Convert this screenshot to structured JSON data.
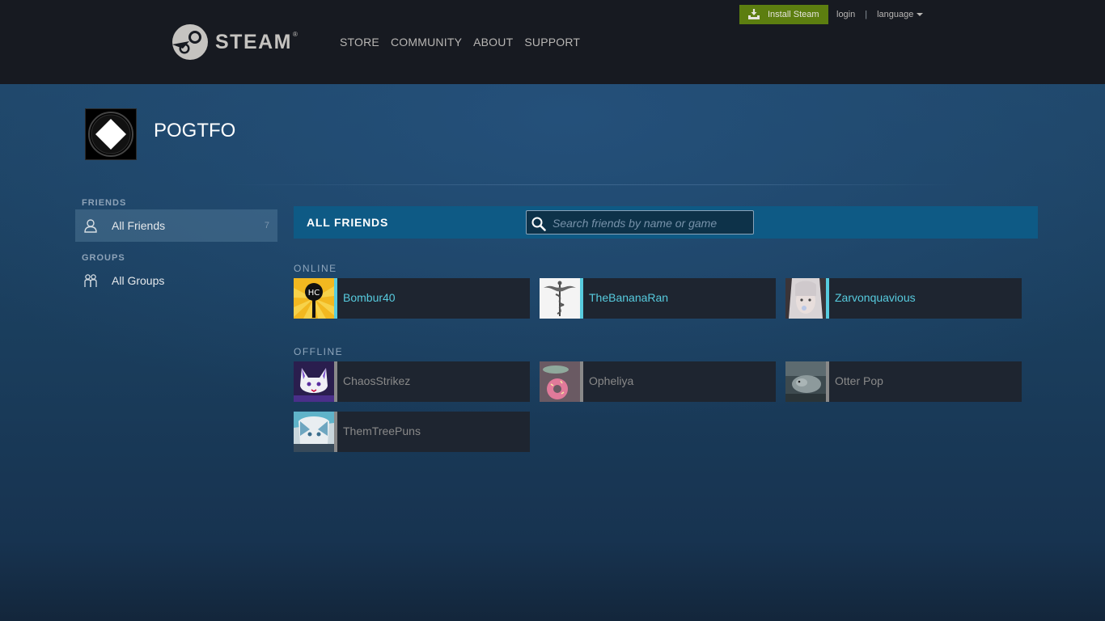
{
  "header": {
    "logo_text": "STEAM",
    "logo_reg": "®",
    "nav": [
      "STORE",
      "COMMUNITY",
      "ABOUT",
      "SUPPORT"
    ],
    "install_label": "Install Steam",
    "login_label": "login",
    "separator": "|",
    "language_label": "language"
  },
  "profile": {
    "name": "POGTFO"
  },
  "sidebar": {
    "friends_label": "FRIENDS",
    "all_friends_label": "All Friends",
    "all_friends_count": "7",
    "groups_label": "GROUPS",
    "all_groups_label": "All Groups"
  },
  "panel": {
    "title": "ALL FRIENDS",
    "search_placeholder": "Search friends by name or game"
  },
  "online": {
    "label": "ONLINE",
    "friends": [
      "Bombur40",
      "TheBananaRan",
      "Zarvonquavious"
    ]
  },
  "offline": {
    "label": "OFFLINE",
    "friends": [
      "ChaosStrikez",
      "Opheliya",
      "Otter Pop",
      "ThemTreePuns"
    ]
  },
  "colors": {
    "online": "#57cbde",
    "offline": "#898989",
    "install_button": "#5c7e10",
    "panel_header": "#0e5a85"
  }
}
